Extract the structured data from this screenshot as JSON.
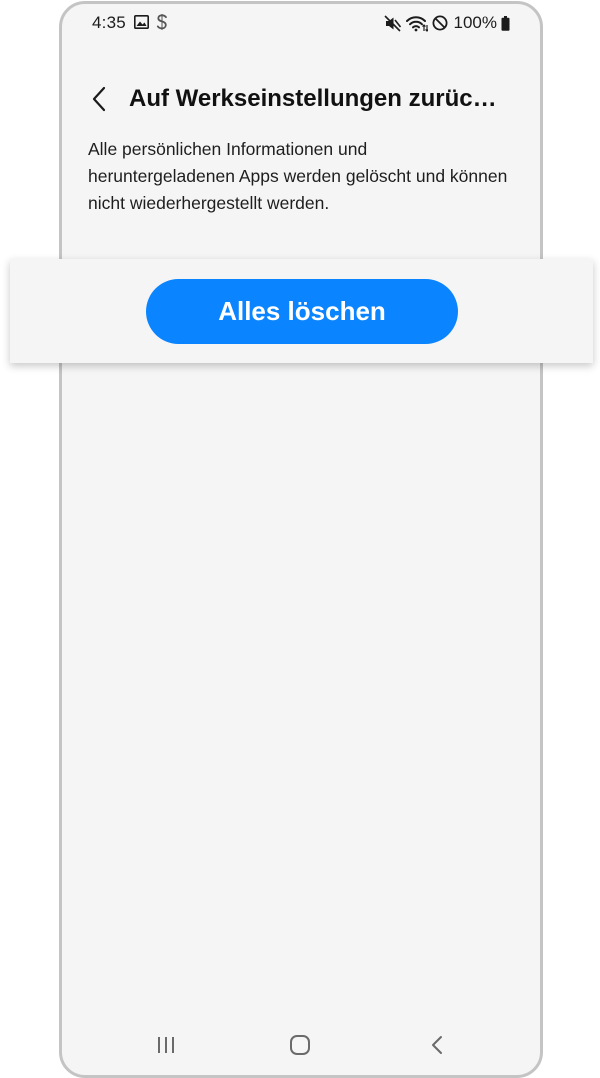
{
  "status_bar": {
    "time": "4:35",
    "left_icons": [
      "image-icon",
      "s-notification-icon"
    ],
    "right_icons": [
      "mute-icon",
      "wifi-icon",
      "do-not-disturb-icon"
    ],
    "battery": "100%"
  },
  "header": {
    "title": "Auf Werkseinstellungen zurüc…"
  },
  "content": {
    "description": "Alle persönlichen Informationen und heruntergeladenen Apps werden gelöscht und können nicht wiederhergestellt werden."
  },
  "actions": {
    "delete_all_label": "Alles löschen"
  },
  "nav_bar": {
    "items": [
      "recents-icon",
      "home-icon",
      "back-icon"
    ]
  },
  "colors": {
    "accent": "#0a84ff",
    "background": "#f5f5f5",
    "frame": "#c4c4c4"
  }
}
